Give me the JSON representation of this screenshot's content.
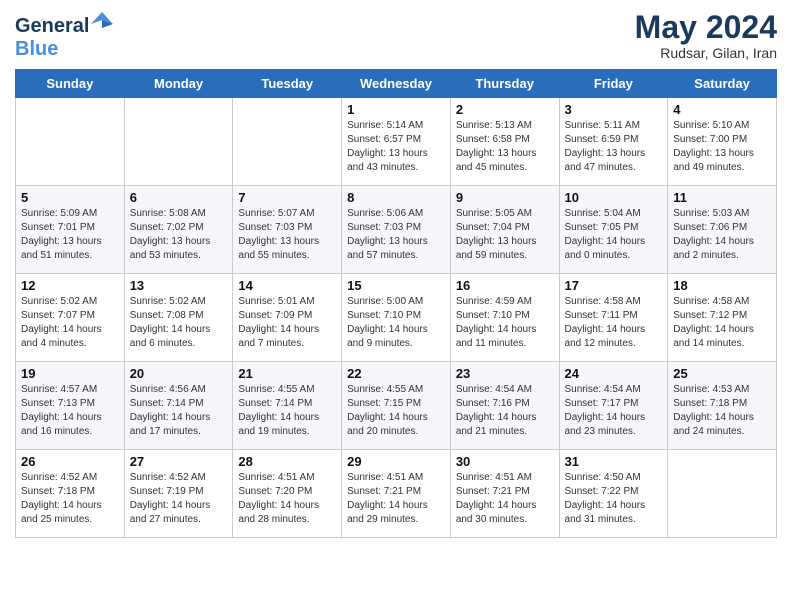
{
  "header": {
    "logo_line1": "General",
    "logo_line2": "Blue",
    "month": "May 2024",
    "location": "Rudsar, Gilan, Iran"
  },
  "weekdays": [
    "Sunday",
    "Monday",
    "Tuesday",
    "Wednesday",
    "Thursday",
    "Friday",
    "Saturday"
  ],
  "weeks": [
    [
      {
        "day": "",
        "info": ""
      },
      {
        "day": "",
        "info": ""
      },
      {
        "day": "",
        "info": ""
      },
      {
        "day": "1",
        "info": "Sunrise: 5:14 AM\nSunset: 6:57 PM\nDaylight: 13 hours\nand 43 minutes."
      },
      {
        "day": "2",
        "info": "Sunrise: 5:13 AM\nSunset: 6:58 PM\nDaylight: 13 hours\nand 45 minutes."
      },
      {
        "day": "3",
        "info": "Sunrise: 5:11 AM\nSunset: 6:59 PM\nDaylight: 13 hours\nand 47 minutes."
      },
      {
        "day": "4",
        "info": "Sunrise: 5:10 AM\nSunset: 7:00 PM\nDaylight: 13 hours\nand 49 minutes."
      }
    ],
    [
      {
        "day": "5",
        "info": "Sunrise: 5:09 AM\nSunset: 7:01 PM\nDaylight: 13 hours\nand 51 minutes."
      },
      {
        "day": "6",
        "info": "Sunrise: 5:08 AM\nSunset: 7:02 PM\nDaylight: 13 hours\nand 53 minutes."
      },
      {
        "day": "7",
        "info": "Sunrise: 5:07 AM\nSunset: 7:03 PM\nDaylight: 13 hours\nand 55 minutes."
      },
      {
        "day": "8",
        "info": "Sunrise: 5:06 AM\nSunset: 7:03 PM\nDaylight: 13 hours\nand 57 minutes."
      },
      {
        "day": "9",
        "info": "Sunrise: 5:05 AM\nSunset: 7:04 PM\nDaylight: 13 hours\nand 59 minutes."
      },
      {
        "day": "10",
        "info": "Sunrise: 5:04 AM\nSunset: 7:05 PM\nDaylight: 14 hours\nand 0 minutes."
      },
      {
        "day": "11",
        "info": "Sunrise: 5:03 AM\nSunset: 7:06 PM\nDaylight: 14 hours\nand 2 minutes."
      }
    ],
    [
      {
        "day": "12",
        "info": "Sunrise: 5:02 AM\nSunset: 7:07 PM\nDaylight: 14 hours\nand 4 minutes."
      },
      {
        "day": "13",
        "info": "Sunrise: 5:02 AM\nSunset: 7:08 PM\nDaylight: 14 hours\nand 6 minutes."
      },
      {
        "day": "14",
        "info": "Sunrise: 5:01 AM\nSunset: 7:09 PM\nDaylight: 14 hours\nand 7 minutes."
      },
      {
        "day": "15",
        "info": "Sunrise: 5:00 AM\nSunset: 7:10 PM\nDaylight: 14 hours\nand 9 minutes."
      },
      {
        "day": "16",
        "info": "Sunrise: 4:59 AM\nSunset: 7:10 PM\nDaylight: 14 hours\nand 11 minutes."
      },
      {
        "day": "17",
        "info": "Sunrise: 4:58 AM\nSunset: 7:11 PM\nDaylight: 14 hours\nand 12 minutes."
      },
      {
        "day": "18",
        "info": "Sunrise: 4:58 AM\nSunset: 7:12 PM\nDaylight: 14 hours\nand 14 minutes."
      }
    ],
    [
      {
        "day": "19",
        "info": "Sunrise: 4:57 AM\nSunset: 7:13 PM\nDaylight: 14 hours\nand 16 minutes."
      },
      {
        "day": "20",
        "info": "Sunrise: 4:56 AM\nSunset: 7:14 PM\nDaylight: 14 hours\nand 17 minutes."
      },
      {
        "day": "21",
        "info": "Sunrise: 4:55 AM\nSunset: 7:14 PM\nDaylight: 14 hours\nand 19 minutes."
      },
      {
        "day": "22",
        "info": "Sunrise: 4:55 AM\nSunset: 7:15 PM\nDaylight: 14 hours\nand 20 minutes."
      },
      {
        "day": "23",
        "info": "Sunrise: 4:54 AM\nSunset: 7:16 PM\nDaylight: 14 hours\nand 21 minutes."
      },
      {
        "day": "24",
        "info": "Sunrise: 4:54 AM\nSunset: 7:17 PM\nDaylight: 14 hours\nand 23 minutes."
      },
      {
        "day": "25",
        "info": "Sunrise: 4:53 AM\nSunset: 7:18 PM\nDaylight: 14 hours\nand 24 minutes."
      }
    ],
    [
      {
        "day": "26",
        "info": "Sunrise: 4:52 AM\nSunset: 7:18 PM\nDaylight: 14 hours\nand 25 minutes."
      },
      {
        "day": "27",
        "info": "Sunrise: 4:52 AM\nSunset: 7:19 PM\nDaylight: 14 hours\nand 27 minutes."
      },
      {
        "day": "28",
        "info": "Sunrise: 4:51 AM\nSunset: 7:20 PM\nDaylight: 14 hours\nand 28 minutes."
      },
      {
        "day": "29",
        "info": "Sunrise: 4:51 AM\nSunset: 7:21 PM\nDaylight: 14 hours\nand 29 minutes."
      },
      {
        "day": "30",
        "info": "Sunrise: 4:51 AM\nSunset: 7:21 PM\nDaylight: 14 hours\nand 30 minutes."
      },
      {
        "day": "31",
        "info": "Sunrise: 4:50 AM\nSunset: 7:22 PM\nDaylight: 14 hours\nand 31 minutes."
      },
      {
        "day": "",
        "info": ""
      }
    ]
  ]
}
